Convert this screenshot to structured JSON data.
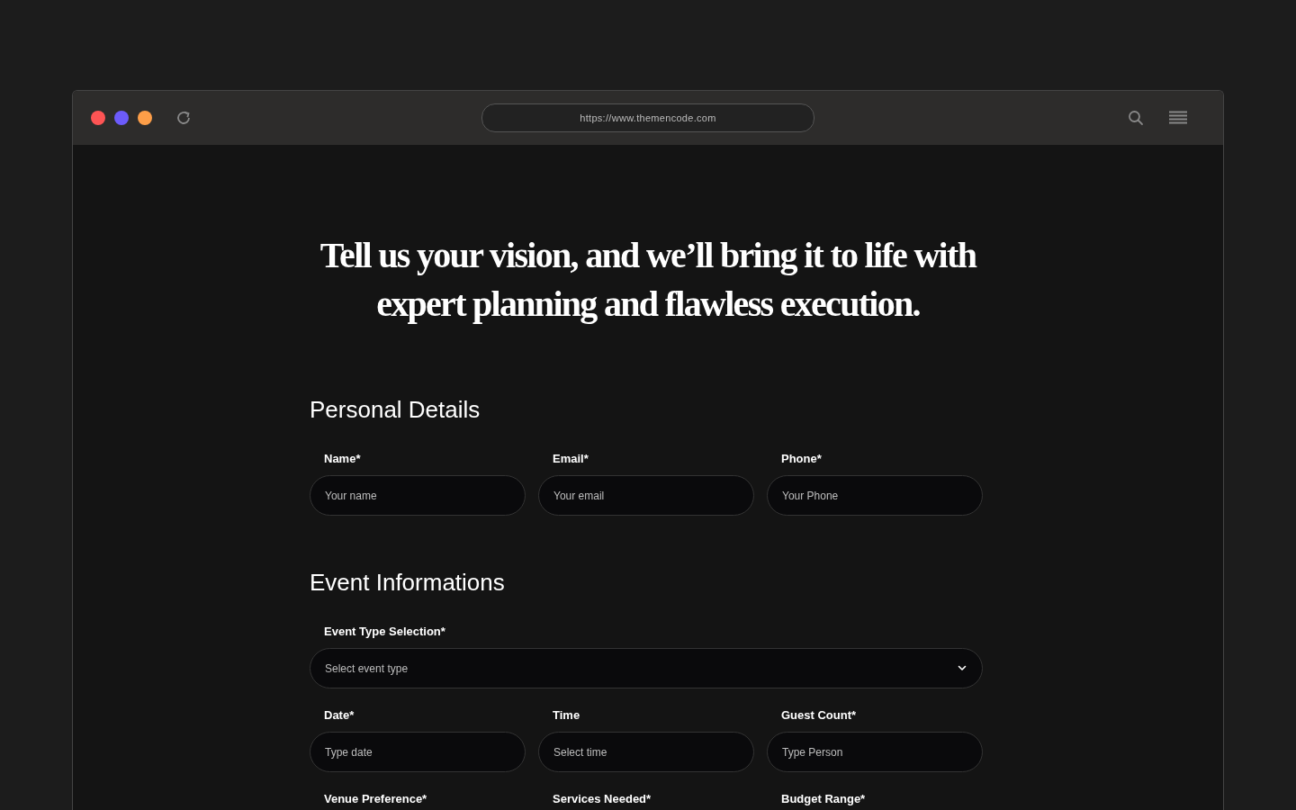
{
  "browser": {
    "dots": [
      {
        "color": "#fe5454"
      },
      {
        "color": "#6c5bfb"
      },
      {
        "color": "#fd9e48"
      }
    ],
    "url": "https://www.themencode.com"
  },
  "heading": "Tell us your vision, and we’ll bring it to life with expert planning and flawless execution.",
  "sections": [
    {
      "title": "Personal Details",
      "rows": [
        [
          {
            "kind": "text",
            "label": "Name*",
            "placeholder": "Your name"
          },
          {
            "kind": "text",
            "label": "Email*",
            "placeholder": "Your email"
          },
          {
            "kind": "text",
            "label": "Phone*",
            "placeholder": "Your Phone"
          }
        ]
      ]
    },
    {
      "title": "Event Informations",
      "rows": [
        [
          {
            "kind": "select",
            "label": "Event Type Selection*",
            "placeholder": "Select event type"
          }
        ],
        [
          {
            "kind": "text",
            "label": "Date*",
            "placeholder": "Type date"
          },
          {
            "kind": "text",
            "label": "Time",
            "placeholder": "Select time"
          },
          {
            "kind": "text",
            "label": "Guest Count*",
            "placeholder": "Type Person"
          }
        ],
        [
          {
            "label": "Venue Preference*"
          },
          {
            "label": "Services Needed*"
          },
          {
            "label": "Budget Range*"
          }
        ]
      ]
    }
  ]
}
